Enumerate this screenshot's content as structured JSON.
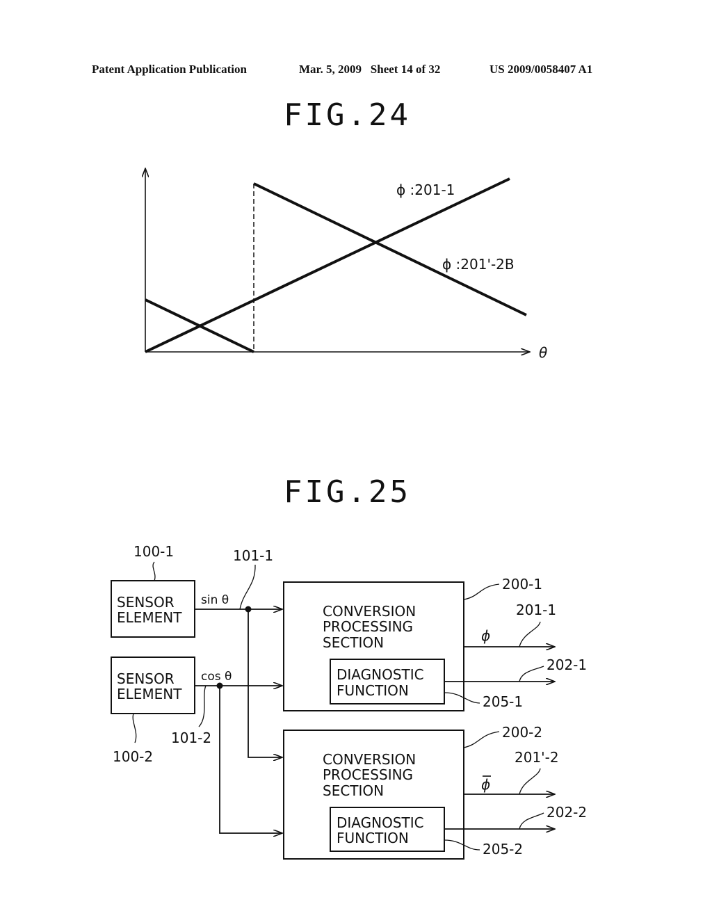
{
  "header": {
    "left": "Patent Application Publication",
    "date_sheet": "Mar. 5, 2009   Sheet 14 of 32",
    "number": "US 2009/0058407 A1"
  },
  "fig24": {
    "title": "FIG.24",
    "x_axis_label": "θ",
    "curve_labels": [
      "ϕ :201-1",
      "ϕ :201'-2B"
    ]
  },
  "fig25": {
    "title": "FIG.25",
    "sensors": [
      {
        "ref": "100-1",
        "line1": "SENSOR",
        "line2": "ELEMENT",
        "signal": "sin θ",
        "signal_ref": "101-1"
      },
      {
        "ref": "100-2",
        "line1": "SENSOR",
        "line2": "ELEMENT",
        "signal": "cos θ",
        "signal_ref": "101-2"
      }
    ],
    "sections": [
      {
        "ref": "200-1",
        "line1": "CONVERSION",
        "line2": "PROCESSING",
        "line3": "SECTION",
        "diag_line1": "DIAGNOSTIC",
        "diag_line2": "FUNCTION",
        "diag_ref": "205-1",
        "out_symbol": "ϕ",
        "out_ref": "201-1",
        "diag_out_ref": "202-1"
      },
      {
        "ref": "200-2",
        "line1": "CONVERSION",
        "line2": "PROCESSING",
        "line3": "SECTION",
        "diag_line1": "DIAGNOSTIC",
        "diag_line2": "FUNCTION",
        "diag_ref": "205-2",
        "out_symbol": "ϕ",
        "out_ref": "201'-2",
        "diag_out_ref": "202-2"
      }
    ]
  }
}
